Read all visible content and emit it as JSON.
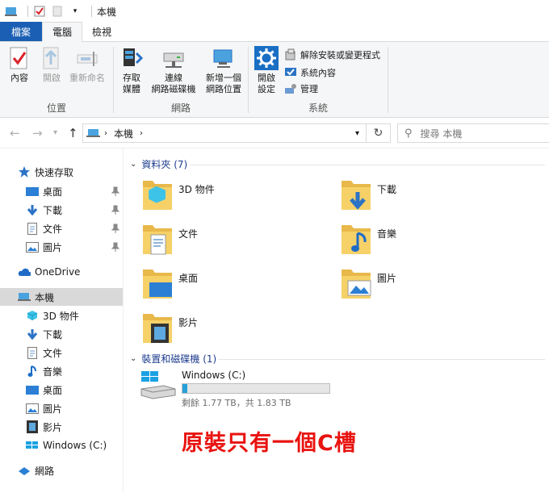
{
  "window": {
    "title": "本機"
  },
  "ribbon_tabs": [
    "檔案",
    "電腦",
    "檢視"
  ],
  "ribbon": {
    "location": {
      "label": "位置",
      "open_props": "內容",
      "open": "開啟",
      "rename": "重新命名"
    },
    "network": {
      "label": "網路",
      "media": "存取\n媒體",
      "map_drive": "連線\n網路磁碟機",
      "add_location": "新增一個\n網路位置"
    },
    "system": {
      "label": "系統",
      "settings": "開啟\n設定",
      "uninstall": "解除安裝或變更程式",
      "sys_props": "系統內容",
      "manage": "管理"
    }
  },
  "address": {
    "path": "本機",
    "search_placeholder": "搜尋 本機"
  },
  "sidebar": {
    "quick_access": "快速存取",
    "quick_items": [
      "桌面",
      "下載",
      "文件",
      "圖片"
    ],
    "onedrive": "OneDrive",
    "this_pc": "本機",
    "pc_items": [
      "3D 物件",
      "下載",
      "文件",
      "音樂",
      "桌面",
      "圖片",
      "影片",
      "Windows (C:)"
    ],
    "network": "網路"
  },
  "content": {
    "folders_header": "資料夾 (7)",
    "folders": [
      "3D 物件",
      "下載",
      "文件",
      "音樂",
      "桌面",
      "圖片",
      "影片"
    ],
    "devices_header": "裝置和磁碟機 (1)",
    "drive": {
      "name": "Windows (C:)",
      "free_text": "剩餘 1.77 TB，共 1.83 TB",
      "used_fraction": 0.033
    }
  },
  "annotation": "原裝只有一個C槽",
  "colors": {
    "accent": "#1a5fb4",
    "annotation": "#e8130f",
    "drive_bar": "#26a0da"
  }
}
